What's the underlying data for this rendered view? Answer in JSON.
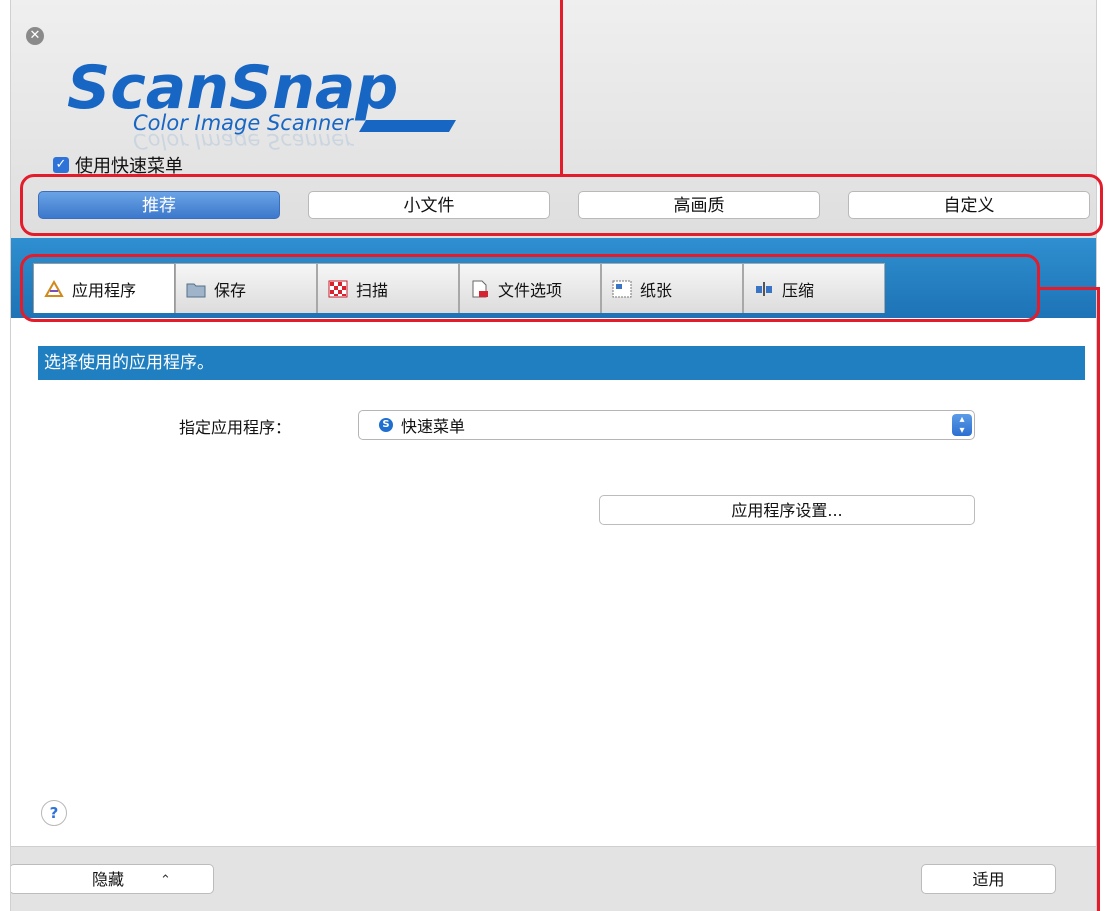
{
  "header": {
    "close_glyph": "✕",
    "logo": {
      "brand": "ScanSnap",
      "tagline": "Color Image Scanner"
    },
    "quick_menu_checkbox": {
      "label": "使用快速菜单",
      "checked": true
    }
  },
  "modes": [
    {
      "label": "推荐",
      "active": true
    },
    {
      "label": "小文件",
      "active": false
    },
    {
      "label": "高画质",
      "active": false
    },
    {
      "label": "自定义",
      "active": false
    }
  ],
  "tabs": [
    {
      "label": "应用程序",
      "icon": "application-icon",
      "active": true
    },
    {
      "label": "保存",
      "icon": "folder-icon",
      "active": false
    },
    {
      "label": "扫描",
      "icon": "scan-icon",
      "active": false
    },
    {
      "label": "文件选项",
      "icon": "file-option-icon",
      "active": false
    },
    {
      "label": "纸张",
      "icon": "paper-icon",
      "active": false
    },
    {
      "label": "压缩",
      "icon": "compression-icon",
      "active": false
    }
  ],
  "content": {
    "section_title": "选择使用的应用程序。",
    "app_label": "指定应用程序：",
    "app_select": {
      "value": "快速菜单",
      "icon": "scansnap-s-icon"
    },
    "settings_button": "应用程序设置..."
  },
  "help_glyph": "?",
  "footer": {
    "hide_button": "隐藏",
    "hide_chevron": "⌃",
    "apply_button": "适用"
  },
  "colors": {
    "accent_blue": "#1f7fc0",
    "highlight_red": "#e31c2b",
    "active_button_blue": "#3c78cc"
  }
}
